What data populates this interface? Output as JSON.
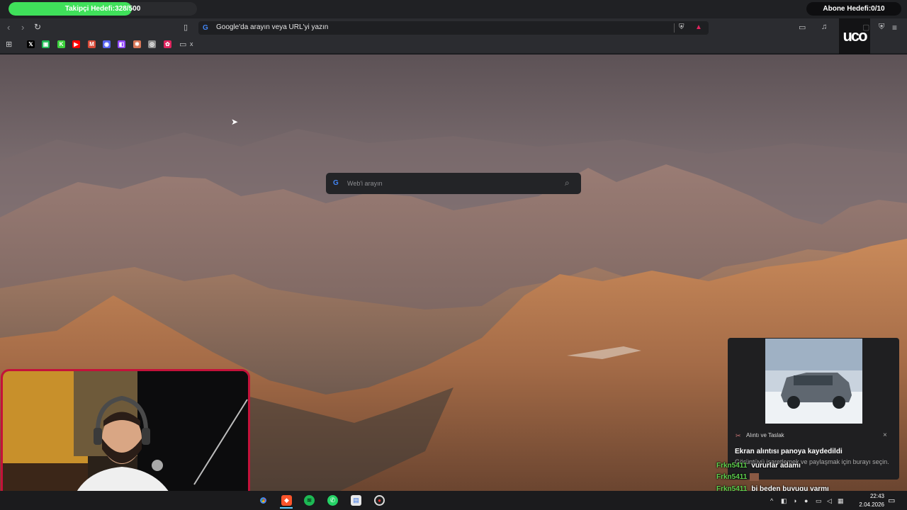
{
  "overlay": {
    "follow_goal": "Takipçi Hedefi:328/500",
    "follow_progress": 0.656,
    "follow_color": "#3fe05a",
    "sub_goal": "Abone Hedefi:0/10"
  },
  "browser": {
    "address_placeholder": "Google'da arayın veya URL'yi yazın",
    "bookmarks": [
      {
        "name": "x-icon",
        "glyph": "𝕏",
        "color": "#000000"
      },
      {
        "name": "kick-alt-icon",
        "glyph": "▣",
        "color": "#1db954"
      },
      {
        "name": "kick-icon",
        "glyph": "K",
        "color": "#3dd13d"
      },
      {
        "name": "youtube-icon",
        "glyph": "▶",
        "color": "#ff0000"
      },
      {
        "name": "gmail-icon",
        "glyph": "M",
        "color": "#d84a38"
      },
      {
        "name": "discord-icon",
        "glyph": "◉",
        "color": "#5865f2"
      },
      {
        "name": "twitch-icon",
        "glyph": "◧",
        "color": "#9146ff"
      },
      {
        "name": "claude-icon",
        "glyph": "✱",
        "color": "#d97757"
      },
      {
        "name": "chatgpt-icon",
        "glyph": "◎",
        "color": "#8e8e8e"
      },
      {
        "name": "app-icon",
        "glyph": "✿",
        "color": "#e0245e"
      }
    ],
    "folder_label": "x"
  },
  "newtab": {
    "search_placeholder": "Web'i arayın"
  },
  "notification": {
    "app": "Alıntı ve Taslak",
    "title": "Ekran alıntısı panoya kaydedildi",
    "body": "Görüntüyü işaretlemek ve paylaşmak için burayı seçin."
  },
  "chat": [
    {
      "user": "Frkn5411",
      "message": "vururlar adamı",
      "emote": false
    },
    {
      "user": "Frkn5411",
      "message": "",
      "emote": true
    },
    {
      "user": "Frkn5411",
      "message": "bi beden buyugu varmı",
      "emote": false
    },
    {
      "user": "Frkn5411",
      "message": "",
      "emote": true
    }
  ],
  "taskbar": {
    "time": "22:43",
    "date": "2.04.2026"
  },
  "watermark": "uco"
}
